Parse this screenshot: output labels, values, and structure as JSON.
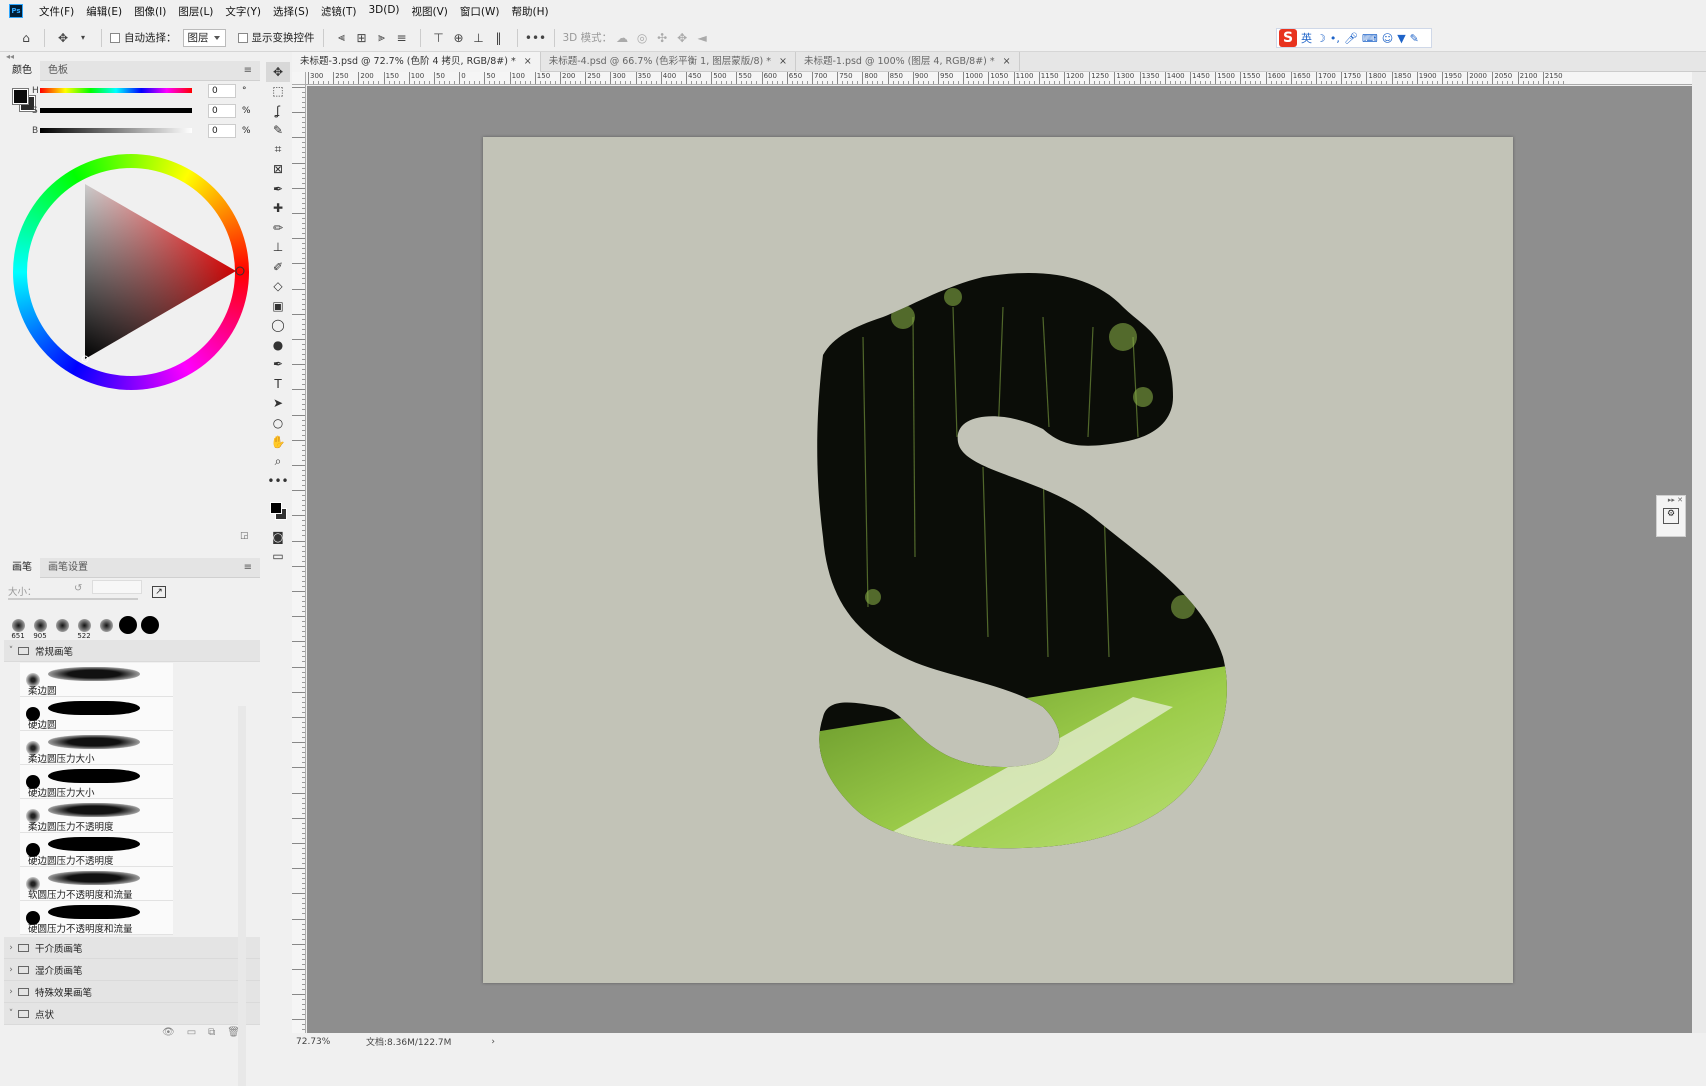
{
  "menubar": {
    "app_icon": "Ps",
    "items": [
      "文件(F)",
      "编辑(E)",
      "图像(I)",
      "图层(L)",
      "文字(Y)",
      "选择(S)",
      "滤镜(T)",
      "3D(D)",
      "视图(V)",
      "窗口(W)",
      "帮助(H)"
    ]
  },
  "options": {
    "auto_select_label": "自动选择：",
    "auto_select_value": "图层",
    "show_transform_label": "显示变换控件",
    "mode_3d_label": "3D 模式："
  },
  "ime": {
    "logo": "S",
    "lang": "英"
  },
  "color_panel": {
    "tabs": [
      "颜色",
      "色板"
    ],
    "h_label": "H",
    "s_label": "S",
    "b_label": "B",
    "h_value": "0",
    "s_value": "0",
    "b_value": "0",
    "h_unit": "°",
    "s_unit": "%",
    "b_unit": "%"
  },
  "brush_panel": {
    "tabs": [
      "画笔",
      "画笔设置"
    ],
    "size_label": "大小：",
    "presets": [
      "651",
      "905",
      "",
      "522",
      "",
      "",
      ""
    ],
    "group_open": "常规画笔",
    "brushes": [
      {
        "name": "柔边圆",
        "hard": false
      },
      {
        "name": "硬边圆",
        "hard": true
      },
      {
        "name": "柔边圆压力大小",
        "hard": false
      },
      {
        "name": "硬边圆压力大小",
        "hard": true
      },
      {
        "name": "柔边圆压力不透明度",
        "hard": false
      },
      {
        "name": "硬边圆压力不透明度",
        "hard": true
      },
      {
        "name": "软圆压力不透明度和流量",
        "hard": false
      },
      {
        "name": "硬圆压力不透明度和流量",
        "hard": true
      }
    ],
    "groups": [
      "干介质画笔",
      "湿介质画笔",
      "特殊效果画笔",
      "点状"
    ]
  },
  "doc_tabs": [
    {
      "label": "未标题-3.psd @ 72.7% (色阶 4 拷贝, RGB/8#) *",
      "active": true
    },
    {
      "label": "未标题-4.psd @ 66.7% (色彩平衡 1, 图层蒙版/8) *",
      "active": false
    },
    {
      "label": "未标题-1.psd @ 100% (图层 4, RGB/8#) *",
      "active": false
    }
  ],
  "ruler_labels": [
    "300",
    "250",
    "200",
    "150",
    "100",
    "50",
    "0",
    "50",
    "100",
    "150",
    "200",
    "250",
    "300",
    "350",
    "400",
    "450",
    "500",
    "550",
    "600",
    "650",
    "700",
    "750",
    "800",
    "850",
    "900",
    "950",
    "1000",
    "1050",
    "1100",
    "1150",
    "1200",
    "1250",
    "1300",
    "1350",
    "1400",
    "1450",
    "1500",
    "1550",
    "1600",
    "1650",
    "1700",
    "1750",
    "1800",
    "1850",
    "1900",
    "1950",
    "2000",
    "2050",
    "2100",
    "2150"
  ],
  "status": {
    "zoom": "72.73%",
    "doc_size": "文档:8.36M/122.7M"
  },
  "colors": {
    "canvas_bg": "#8e8e8e",
    "doc_bg": "#c2c3b7",
    "forest_dark": "#0b0d08",
    "grass": "#7fae3a"
  }
}
